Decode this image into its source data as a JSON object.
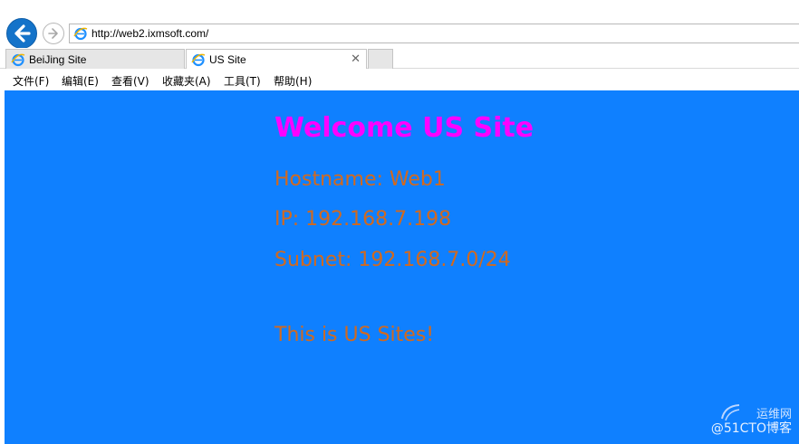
{
  "address_bar": {
    "url": "http://web2.ixmsoft.com/"
  },
  "tabs": [
    {
      "title": "BeiJing Site",
      "active": false
    },
    {
      "title": "US Site",
      "active": true,
      "close_glyph": "✕"
    }
  ],
  "menu": [
    {
      "label": "文件(F)"
    },
    {
      "label": "编辑(E)"
    },
    {
      "label": "查看(V)"
    },
    {
      "label": "收藏夹(A)"
    },
    {
      "label": "工具(T)"
    },
    {
      "label": "帮助(H)"
    }
  ],
  "page": {
    "background_color": "#0f80ff",
    "heading": "Welcome US Site",
    "heading_color": "#ff00ff",
    "text_color": "#d2691e",
    "hostname": "Hostname: Web1",
    "ip": "IP: 192.168.7.198",
    "subnet": "Subnet: 192.168.7.0/24",
    "footer": "This is US Sites!"
  },
  "watermark": {
    "line1": "运维网",
    "line2": "@51CTO博客"
  },
  "icons": {
    "back": "back-arrow-icon",
    "forward": "forward-arrow-icon",
    "ie": "internet-explorer-icon",
    "close": "close-icon"
  }
}
